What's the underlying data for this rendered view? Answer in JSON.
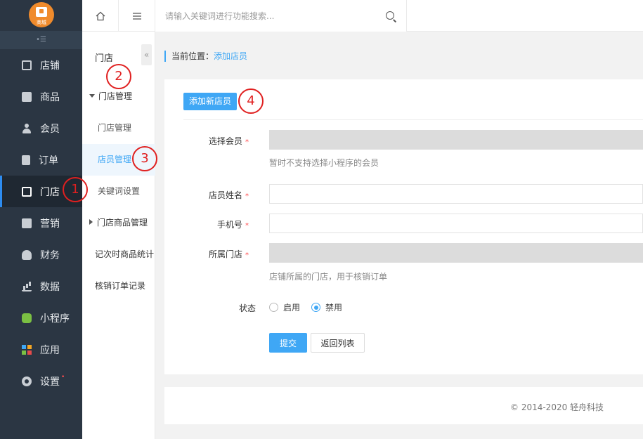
{
  "brand": {
    "logo_text": "商城"
  },
  "nav": {
    "items": [
      {
        "label": "店铺",
        "icon": "store-icon"
      },
      {
        "label": "商品",
        "icon": "goods-icon"
      },
      {
        "label": "会员",
        "icon": "user-icon"
      },
      {
        "label": "订单",
        "icon": "order-icon"
      },
      {
        "label": "门店",
        "icon": "shop-icon",
        "active": true
      },
      {
        "label": "营销",
        "icon": "gift-icon"
      },
      {
        "label": "财务",
        "icon": "money-bag-icon"
      },
      {
        "label": "数据",
        "icon": "bar-chart-icon"
      },
      {
        "label": "小程序",
        "icon": "miniapp-icon"
      },
      {
        "label": "应用",
        "icon": "apps-icon"
      },
      {
        "label": "设置",
        "icon": "gear-icon",
        "badge": "•"
      }
    ],
    "collapse_glyph": "•☰"
  },
  "subnav": {
    "title": "门店",
    "fold_glyph": "«",
    "items": [
      {
        "label": "门店管理",
        "type": "group-open"
      },
      {
        "label": "门店管理",
        "type": "leaf"
      },
      {
        "label": "店员管理",
        "type": "leaf",
        "active": true
      },
      {
        "label": "关键词设置",
        "type": "leaf"
      },
      {
        "label": "门店商品管理",
        "type": "group-closed"
      },
      {
        "label": "记次时商品统计",
        "type": "plain"
      },
      {
        "label": "核销订单记录",
        "type": "plain"
      }
    ]
  },
  "topbar": {
    "search_placeholder": "请输入关键词进行功能搜索..."
  },
  "breadcrumb": {
    "label": "当前位置：",
    "current": "添加店员"
  },
  "form": {
    "tab_label": "添加新店员",
    "fields": {
      "member": {
        "label": "选择会员",
        "help": "暂时不支持选择小程序的会员"
      },
      "name": {
        "label": "店员姓名"
      },
      "phone": {
        "label": "手机号"
      },
      "store": {
        "label": "所属门店",
        "help": "店铺所属的门店，用于核销订单"
      },
      "status": {
        "label": "状态",
        "options": [
          "启用",
          "禁用"
        ],
        "selected": "禁用"
      }
    },
    "submit_label": "提交",
    "back_label": "返回列表"
  },
  "footer": {
    "copyright": "© 2014-2020 轻舟科技"
  },
  "annotations": [
    "1",
    "2",
    "3",
    "4"
  ],
  "colors": {
    "accent": "#3fa7f5",
    "sidebar": "#2b3643",
    "annotation": "#e02020",
    "logo": "#f08b2c"
  }
}
